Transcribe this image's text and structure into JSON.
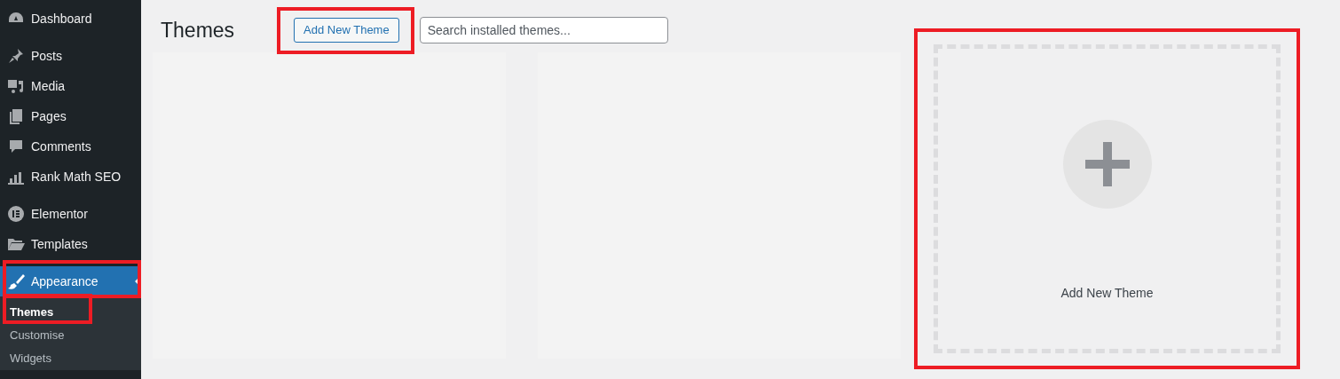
{
  "sidebar": {
    "groups": [
      [
        {
          "label": "Dashboard",
          "selected": false,
          "highlighted": false
        }
      ],
      [
        {
          "label": "Posts",
          "selected": false,
          "highlighted": false
        },
        {
          "label": "Media",
          "selected": false,
          "highlighted": false
        },
        {
          "label": "Pages",
          "selected": false,
          "highlighted": false
        },
        {
          "label": "Comments",
          "selected": false,
          "highlighted": false
        },
        {
          "label": "Rank Math SEO",
          "selected": false,
          "highlighted": false
        }
      ],
      [
        {
          "label": "Elementor",
          "selected": false,
          "highlighted": false
        },
        {
          "label": "Templates",
          "selected": false,
          "highlighted": false
        }
      ],
      [
        {
          "label": "Appearance",
          "selected": true,
          "highlighted": true,
          "children": [
            {
              "label": "Themes",
              "selected": true,
              "highlighted": true
            },
            {
              "label": "Customise",
              "selected": false,
              "highlighted": false
            },
            {
              "label": "Widgets",
              "selected": false,
              "highlighted": false
            }
          ]
        }
      ]
    ]
  },
  "page": {
    "title": "Themes",
    "add_button": {
      "label": "Add New Theme",
      "highlighted": true
    },
    "search": {
      "placeholder": "Search installed themes..."
    }
  },
  "theme_cards": [
    {
      "kind": "placeholder"
    },
    {
      "kind": "placeholder"
    },
    {
      "kind": "add_new",
      "label": "Add New Theme",
      "highlighted": true
    }
  ]
}
